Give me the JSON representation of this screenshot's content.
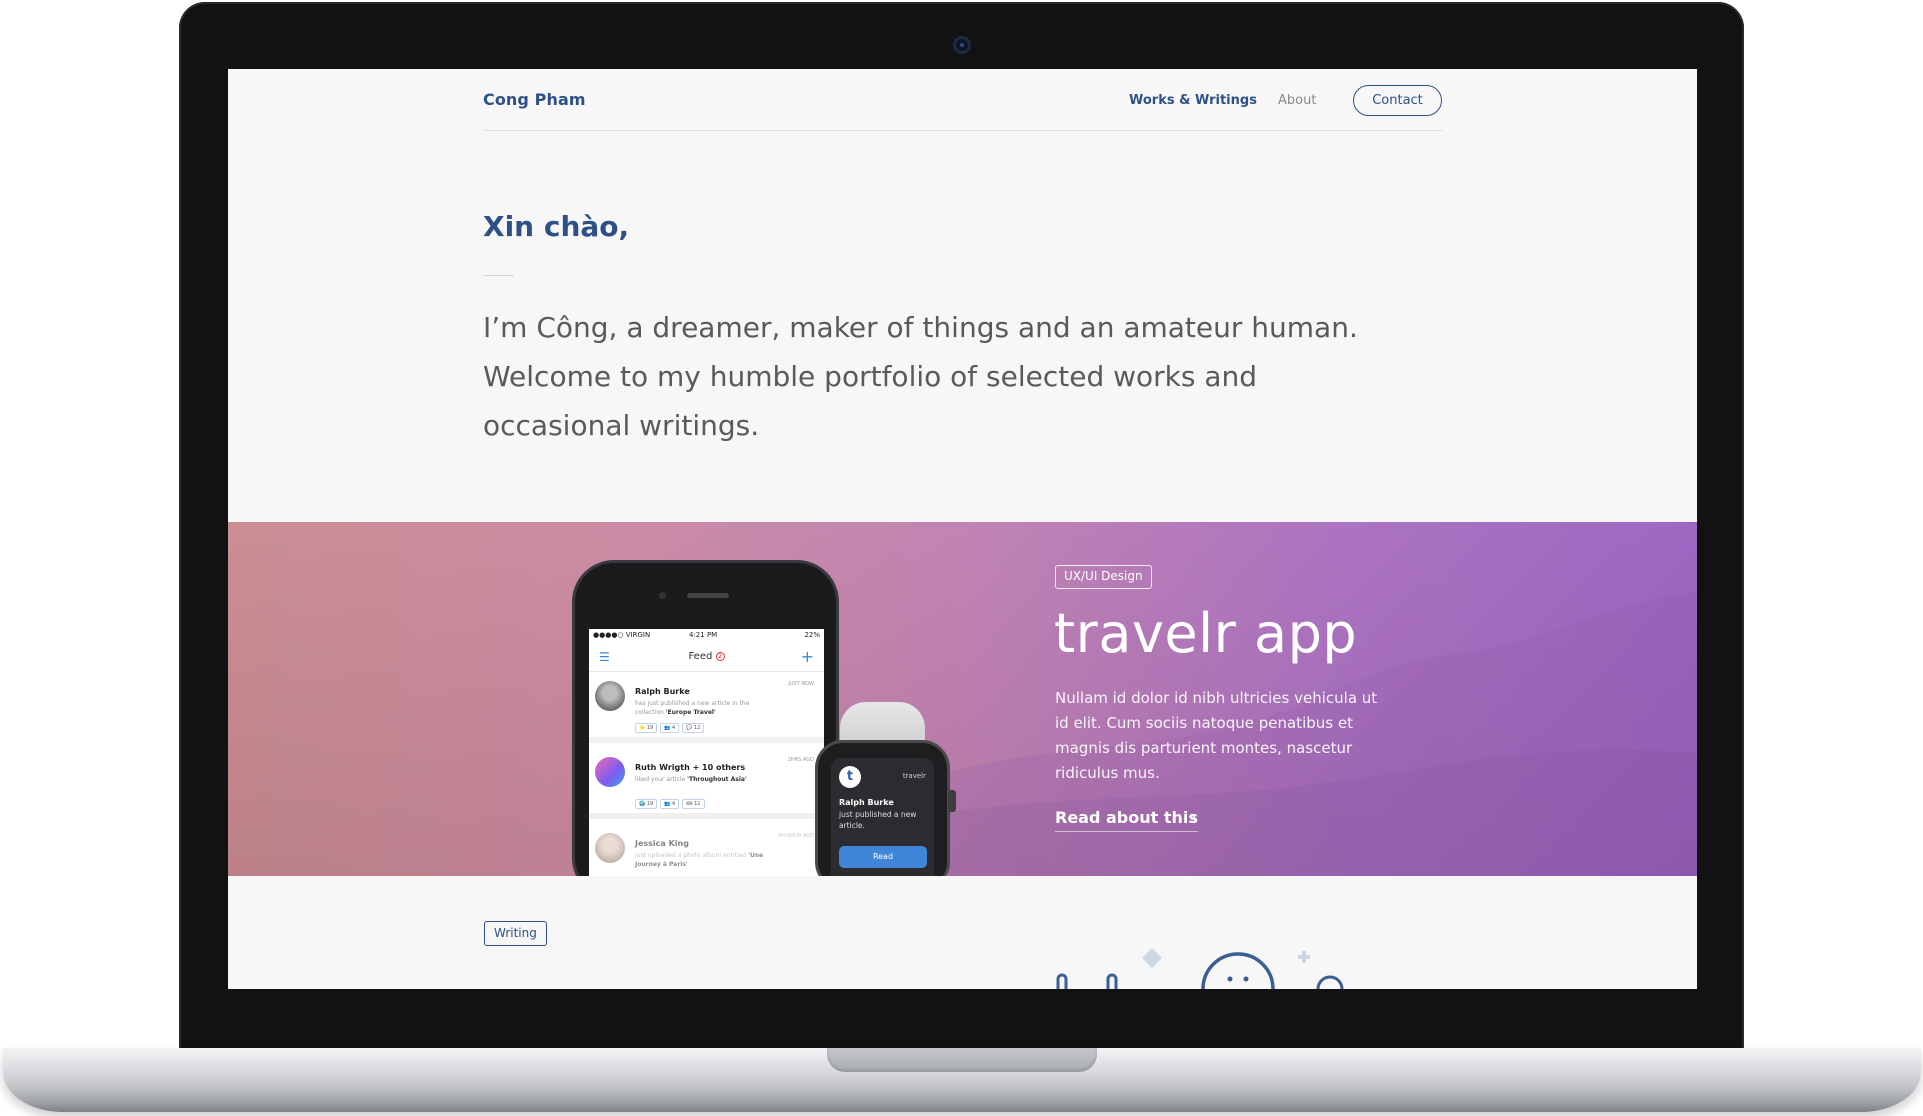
{
  "site": {
    "brand": "Cong Pham",
    "nav": {
      "works": "Works & Writings",
      "about": "About",
      "contact": "Contact"
    }
  },
  "hero": {
    "greeting": "Xin chào,",
    "intro": "I’m Công, a dreamer, maker of things and an amateur human. Welcome to my humble portfolio of selected works and occasional writings."
  },
  "featured": {
    "tag": "UX/UI Design",
    "title": "travelr app",
    "description": "Nullam id dolor id nibh ultricies vehicula ut id elit. Cum sociis natoque penatibus et magnis dis parturient montes, nascetur ridiculus mus.",
    "cta": "Read about this",
    "phone": {
      "status": {
        "carrier": "●●●●○ VIRGIN",
        "time": "4:21 PM",
        "battery": "22%"
      },
      "feed_title": "Feed",
      "feed_badge": "2",
      "items": [
        {
          "name": "Ralph Burke",
          "time": "JUST NOW",
          "text": "has just published a new article in the collection",
          "highlight": "'Europe Travel'",
          "chips": [
            "⭐ 19",
            "👥 4",
            "💬 12"
          ]
        },
        {
          "name": "Ruth Wrigth + 10 others",
          "time": "2HRS AGO",
          "text": "liked your article",
          "highlight": "'Throughout Asia'",
          "chips": [
            "🌍 19",
            "👥 4",
            "🎟 12"
          ]
        },
        {
          "name": "Jessica King",
          "time": "6H HOUR AGO",
          "text": "just uploaded a photo album entitled",
          "highlight": "'Une Journey à Paris'",
          "chips": []
        }
      ]
    },
    "watch": {
      "logo": "t",
      "app": "travelr",
      "name": "Ralph Burke",
      "message": "just published a new article.",
      "button": "Read"
    }
  },
  "writing": {
    "tag": "Writing"
  },
  "colors": {
    "brand_blue": "#2d5187",
    "body_text": "#5a5a5a",
    "banner_start": "#c78a8f",
    "banner_end": "#9a61c0"
  }
}
